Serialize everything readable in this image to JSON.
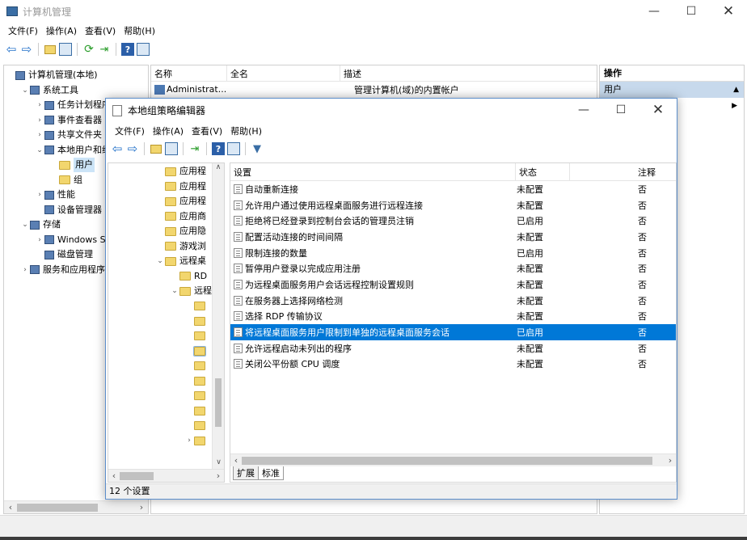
{
  "outer": {
    "title": "计算机管理",
    "menu": [
      "文件(F)",
      "操作(A)",
      "查看(V)",
      "帮助(H)"
    ],
    "tree": [
      {
        "label": "计算机管理(本地)",
        "indent": 0,
        "exp": "",
        "icon": "computer-icon"
      },
      {
        "label": "系统工具",
        "indent": 1,
        "exp": "⌄",
        "icon": "tools-icon"
      },
      {
        "label": "任务计划程序",
        "indent": 2,
        "exp": "›",
        "icon": "clock-icon"
      },
      {
        "label": "事件查看器",
        "indent": 2,
        "exp": "›",
        "icon": "event-icon"
      },
      {
        "label": "共享文件夹",
        "indent": 2,
        "exp": "›",
        "icon": "share-icon"
      },
      {
        "label": "本地用户和组",
        "indent": 2,
        "exp": "⌄",
        "icon": "users-icon"
      },
      {
        "label": "用户",
        "indent": 3,
        "exp": "",
        "icon": "folder-icon",
        "selected": true
      },
      {
        "label": "组",
        "indent": 3,
        "exp": "",
        "icon": "folder-icon"
      },
      {
        "label": "性能",
        "indent": 2,
        "exp": "›",
        "icon": "performance-icon"
      },
      {
        "label": "设备管理器",
        "indent": 2,
        "exp": "",
        "icon": "device-icon"
      },
      {
        "label": "存储",
        "indent": 1,
        "exp": "⌄",
        "icon": "storage-icon"
      },
      {
        "label": "Windows Se",
        "indent": 2,
        "exp": "›",
        "icon": "backup-icon"
      },
      {
        "label": "磁盘管理",
        "indent": 2,
        "exp": "",
        "icon": "disk-icon"
      },
      {
        "label": "服务和应用程序",
        "indent": 1,
        "exp": "›",
        "icon": "services-icon"
      }
    ],
    "columns": [
      "名称",
      "全名",
      "描述"
    ],
    "rows": [
      {
        "name": "Administrat...",
        "fullname": "",
        "desc": "管理计算机(域)的内置帐户"
      }
    ],
    "actions": {
      "header": "操作",
      "section": "用户"
    }
  },
  "inner": {
    "title": "本地组策略编辑器",
    "menu": [
      "文件(F)",
      "操作(A)",
      "查看(V)",
      "帮助(H)"
    ],
    "tree": [
      {
        "label": "应用程",
        "indent": 0,
        "exp": ""
      },
      {
        "label": "应用程",
        "indent": 0,
        "exp": ""
      },
      {
        "label": "应用程",
        "indent": 0,
        "exp": ""
      },
      {
        "label": "应用商",
        "indent": 0,
        "exp": ""
      },
      {
        "label": "应用隐",
        "indent": 0,
        "exp": ""
      },
      {
        "label": "游戏浏",
        "indent": 0,
        "exp": ""
      },
      {
        "label": "远程桌",
        "indent": 0,
        "exp": "⌄"
      },
      {
        "label": "RD",
        "indent": 1,
        "exp": ""
      },
      {
        "label": "远程",
        "indent": 1,
        "exp": "⌄"
      },
      {
        "label": "",
        "indent": 2,
        "exp": ""
      },
      {
        "label": "",
        "indent": 2,
        "exp": ""
      },
      {
        "label": "",
        "indent": 2,
        "exp": ""
      },
      {
        "label": "",
        "indent": 2,
        "exp": "",
        "selected": true
      },
      {
        "label": "",
        "indent": 2,
        "exp": ""
      },
      {
        "label": "",
        "indent": 2,
        "exp": ""
      },
      {
        "label": "",
        "indent": 2,
        "exp": ""
      },
      {
        "label": "",
        "indent": 2,
        "exp": ""
      },
      {
        "label": "",
        "indent": 2,
        "exp": ""
      },
      {
        "label": "",
        "indent": 2,
        "exp": "›"
      }
    ],
    "columns": [
      "设置",
      "状态",
      "注释"
    ],
    "settings": [
      {
        "name": "自动重新连接",
        "state": "未配置",
        "note": "否"
      },
      {
        "name": "允许用户通过使用远程桌面服务进行远程连接",
        "state": "未配置",
        "note": "否"
      },
      {
        "name": "拒绝将已经登录到控制台会话的管理员注销",
        "state": "已启用",
        "note": "否"
      },
      {
        "name": "配置活动连接的时间间隔",
        "state": "未配置",
        "note": "否"
      },
      {
        "name": "限制连接的数量",
        "state": "已启用",
        "note": "否"
      },
      {
        "name": "暂停用户登录以完成应用注册",
        "state": "未配置",
        "note": "否"
      },
      {
        "name": "为远程桌面服务用户会话远程控制设置规则",
        "state": "未配置",
        "note": "否"
      },
      {
        "name": "在服务器上选择网络检测",
        "state": "未配置",
        "note": "否"
      },
      {
        "name": "选择 RDP 传输协议",
        "state": "未配置",
        "note": "否"
      },
      {
        "name": "将远程桌面服务用户限制到单独的远程桌面服务会话",
        "state": "已启用",
        "note": "否",
        "selected": true
      },
      {
        "name": "允许远程启动未列出的程序",
        "state": "未配置",
        "note": "否"
      },
      {
        "name": "关闭公平份额 CPU 调度",
        "state": "未配置",
        "note": "否"
      }
    ],
    "tabs": [
      "扩展",
      "标准"
    ],
    "status": "12 个设置"
  }
}
